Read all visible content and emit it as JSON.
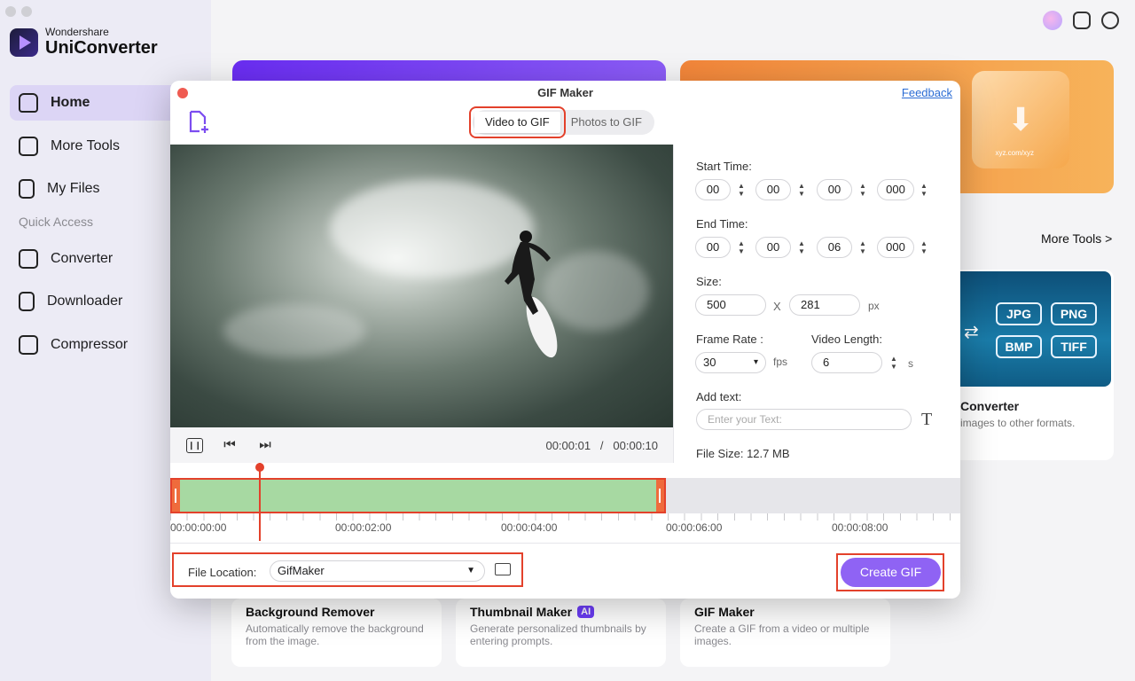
{
  "app": {
    "brand_small": "Wondershare",
    "brand_name": "UniConverter"
  },
  "sidebar": {
    "items": [
      {
        "label": "Home",
        "icon": "home-icon"
      },
      {
        "label": "More Tools",
        "icon": "toolbox-icon"
      },
      {
        "label": "My Files",
        "icon": "file-icon"
      }
    ],
    "section_title": "Quick Access",
    "quick": [
      {
        "label": "Converter",
        "icon": "converter-icon"
      },
      {
        "label": "Downloader",
        "icon": "downloader-icon"
      },
      {
        "label": "Compressor",
        "icon": "compressor-icon"
      }
    ]
  },
  "home": {
    "more_tools_link": "More Tools >",
    "converter_card": {
      "title": "Converter",
      "desc": "images to other formats.",
      "formats": [
        "JPG",
        "PNG",
        "BMP",
        "TIFF"
      ]
    },
    "banner_url_text": "xyz.com/xyz",
    "tools": [
      {
        "title": "Background Remover",
        "desc": "Automatically remove the background from the image."
      },
      {
        "title": "Thumbnail Maker",
        "badge": "AI",
        "desc": "Generate personalized thumbnails by entering prompts."
      },
      {
        "title": "GIF Maker",
        "desc": "Create a GIF from a video or multiple images."
      }
    ]
  },
  "dialog": {
    "title": "GIF Maker",
    "feedback": "Feedback",
    "tabs": [
      "Video to GIF",
      "Photos to GIF"
    ],
    "player": {
      "current": "00:00:01",
      "separator": "/",
      "total": "00:00:10"
    },
    "start_time": {
      "label": "Start Time:",
      "h": "00",
      "m": "00",
      "s": "00",
      "ms": "000"
    },
    "end_time": {
      "label": "End Time:",
      "h": "00",
      "m": "00",
      "s": "06",
      "ms": "000"
    },
    "size": {
      "label": "Size:",
      "width": "500",
      "x": "X",
      "height": "281",
      "unit": "px"
    },
    "frame_rate": {
      "label": "Frame Rate :",
      "value": "30",
      "unit": "fps"
    },
    "video_length": {
      "label": "Video Length:",
      "value": "6",
      "unit": "s"
    },
    "add_text": {
      "label": "Add text:",
      "placeholder": "Enter your Text:"
    },
    "file_size": "File Size:  12.7 MB",
    "timeline": {
      "ticks": [
        "00:00:00:00",
        "00:00:02:00",
        "00:00:04:00",
        "00:00:06:00",
        "00:00:08:00"
      ],
      "playhead_time": "00:00:01",
      "selection_end": "00:00:06"
    },
    "file_location": {
      "label": "File Location:",
      "value": "GifMaker"
    },
    "create_button": "Create GIF"
  },
  "colors": {
    "accent": "#8f63f4",
    "highlight": "#e3412b",
    "range": "#a7d9a2"
  }
}
